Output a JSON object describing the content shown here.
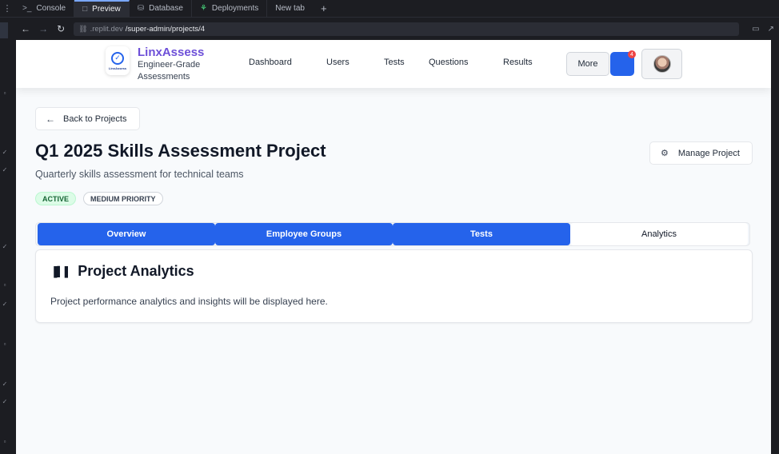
{
  "browser": {
    "tabs": [
      {
        "label": "Console",
        "icon": ">_"
      },
      {
        "label": "Preview",
        "icon": "□"
      },
      {
        "label": "Database",
        "icon": "⛁"
      },
      {
        "label": "Deployments",
        "icon": "⚘"
      },
      {
        "label": "New tab",
        "icon": ""
      }
    ],
    "new_tab_symbol": "+",
    "url_host": ".replit.dev",
    "url_path": "/super-admin/projects/4"
  },
  "app": {
    "brand_name": "LinxAssess",
    "brand_tagline": "Engineer-Grade Assessments",
    "logo_text": "LinxAssess",
    "nav": [
      "Dashboard",
      "Users",
      "Tests",
      "Questions",
      "Results"
    ],
    "more_label": "More",
    "notification_count": "4",
    "brand_color": "#6d4fd8",
    "accent_color": "#2563eb"
  },
  "page": {
    "back_label": "Back to Projects",
    "title": "Q1 2025 Skills Assessment Project",
    "subtitle": "Quarterly skills assessment for technical teams",
    "manage_label": "Manage Project",
    "badges": [
      "ACTIVE",
      "MEDIUM PRIORITY"
    ],
    "tabs": [
      "Overview",
      "Employee Groups",
      "Tests",
      "Analytics"
    ],
    "selected_tab": "Analytics",
    "card_title": "Project Analytics",
    "card_body": "Project performance analytics and insights will be displayed here."
  }
}
